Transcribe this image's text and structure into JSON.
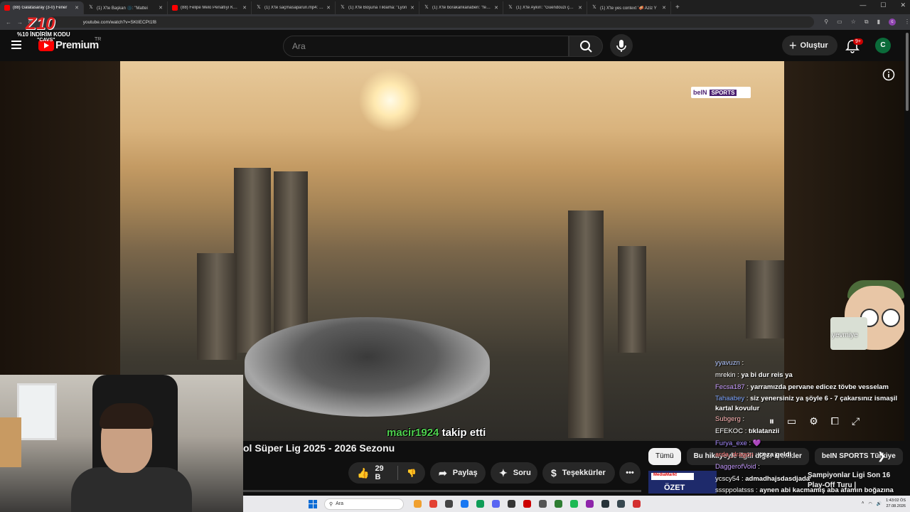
{
  "browser": {
    "tabs": [
      {
        "title": "(88) Galatasaray (3-0) Fener",
        "icon": "youtube-icon",
        "active": true
      },
      {
        "title": "(1) X'te Başkan 🌑: \"Mattei",
        "icon": "x-icon"
      },
      {
        "title": "(88) Felipe Melo Penaltıyı Kurta",
        "icon": "youtube-icon"
      },
      {
        "title": "(1) X'te saçmasaparun.mp4: \"Ben",
        "icon": "x-icon"
      },
      {
        "title": "(1) X'te Boşuna Tıklama: \"Lyon",
        "icon": "x-icon"
      },
      {
        "title": "(1) X'te borakankanaben: \"fener",
        "icon": "x-icon"
      },
      {
        "title": "(1) X'te Aykırı: \"Guendouzi çkur",
        "icon": "x-icon"
      },
      {
        "title": "(1) X'te yes context '🪗 Aziz Y",
        "icon": "x-icon"
      }
    ],
    "url": "youtube.com/watch?v=SKtIECPt1f8",
    "profile_initial": "c"
  },
  "overlay": {
    "logo_text": "Z10",
    "promo_line1": "%10 İNDİRİM KODU",
    "promo_line2": "\"CAVS\""
  },
  "header": {
    "brand": "Premium",
    "region": "TR",
    "search_placeholder": "Ara",
    "create_label": "Oluştur",
    "notification_count": "9+",
    "avatar_initial": "C"
  },
  "video": {
    "channel_watermark_a": "beIN",
    "channel_watermark_b": "SPORTS",
    "follow_user": "macir1924",
    "follow_text": "takip etti",
    "title": "ol Süper Lig 2025 - 2026 Sezonu"
  },
  "actions": {
    "likes": "29 B",
    "share": "Paylaş",
    "ask": "Soru",
    "thanks": "Teşekkürler"
  },
  "chips": [
    "Tümü",
    "Bu hikayeyle ilgili diğer içerikler",
    "beIN SPORTS Türkiye"
  ],
  "recommendation": {
    "thumb_brand": "MediaMarkt",
    "thumb_text": "ÖZET",
    "title": "Şampiyonlar Ligi Son 16 Play-Off Turu |"
  },
  "mascot": {
    "label": "yevmiye"
  },
  "chat": [
    {
      "user": "yyavuzn",
      "text": "",
      "color": "#b0c4ff"
    },
    {
      "user": "mrekin",
      "text": "ya bi dur reis ya",
      "color": "#ffffff"
    },
    {
      "user": "Fecsa187",
      "text": "yarramızda pervane edicez tövbe vesselam",
      "color": "#c79cff"
    },
    {
      "user": "Tahaabey",
      "text": "siz yenersiniz ya şöyle 6 - 7 çakarsınız ismaşil kartal kovulur",
      "color": "#7fa6ff"
    },
    {
      "user": "Subgerg",
      "text": "",
      "color": "#ffb4b4"
    },
    {
      "user": "EFEKOC",
      "text": "tıklatanzii",
      "color": "#ffffff"
    },
    {
      "user": "Furya_exe",
      "text": "💜",
      "color": "#a78bff"
    },
    {
      "user": "arda_dragon",
      "text": "ceza geldi",
      "color": "#ff7a7a"
    },
    {
      "user": "DaggerofVoid",
      "text": "",
      "color": "#c79cff"
    },
    {
      "user": "ycscy54",
      "text": "admadhajsdasdjada",
      "color": "#ffffff"
    },
    {
      "user": "sssppolatsss",
      "text": "aynen abi kacmamış aba afamın boğazına yapışması serbest futbol brooo gs brooo",
      "color": "#ffffff"
    }
  ],
  "taskbar": {
    "search_placeholder": "Ara",
    "time": "1:43:02 ÖS",
    "date": "27.08.2026"
  }
}
